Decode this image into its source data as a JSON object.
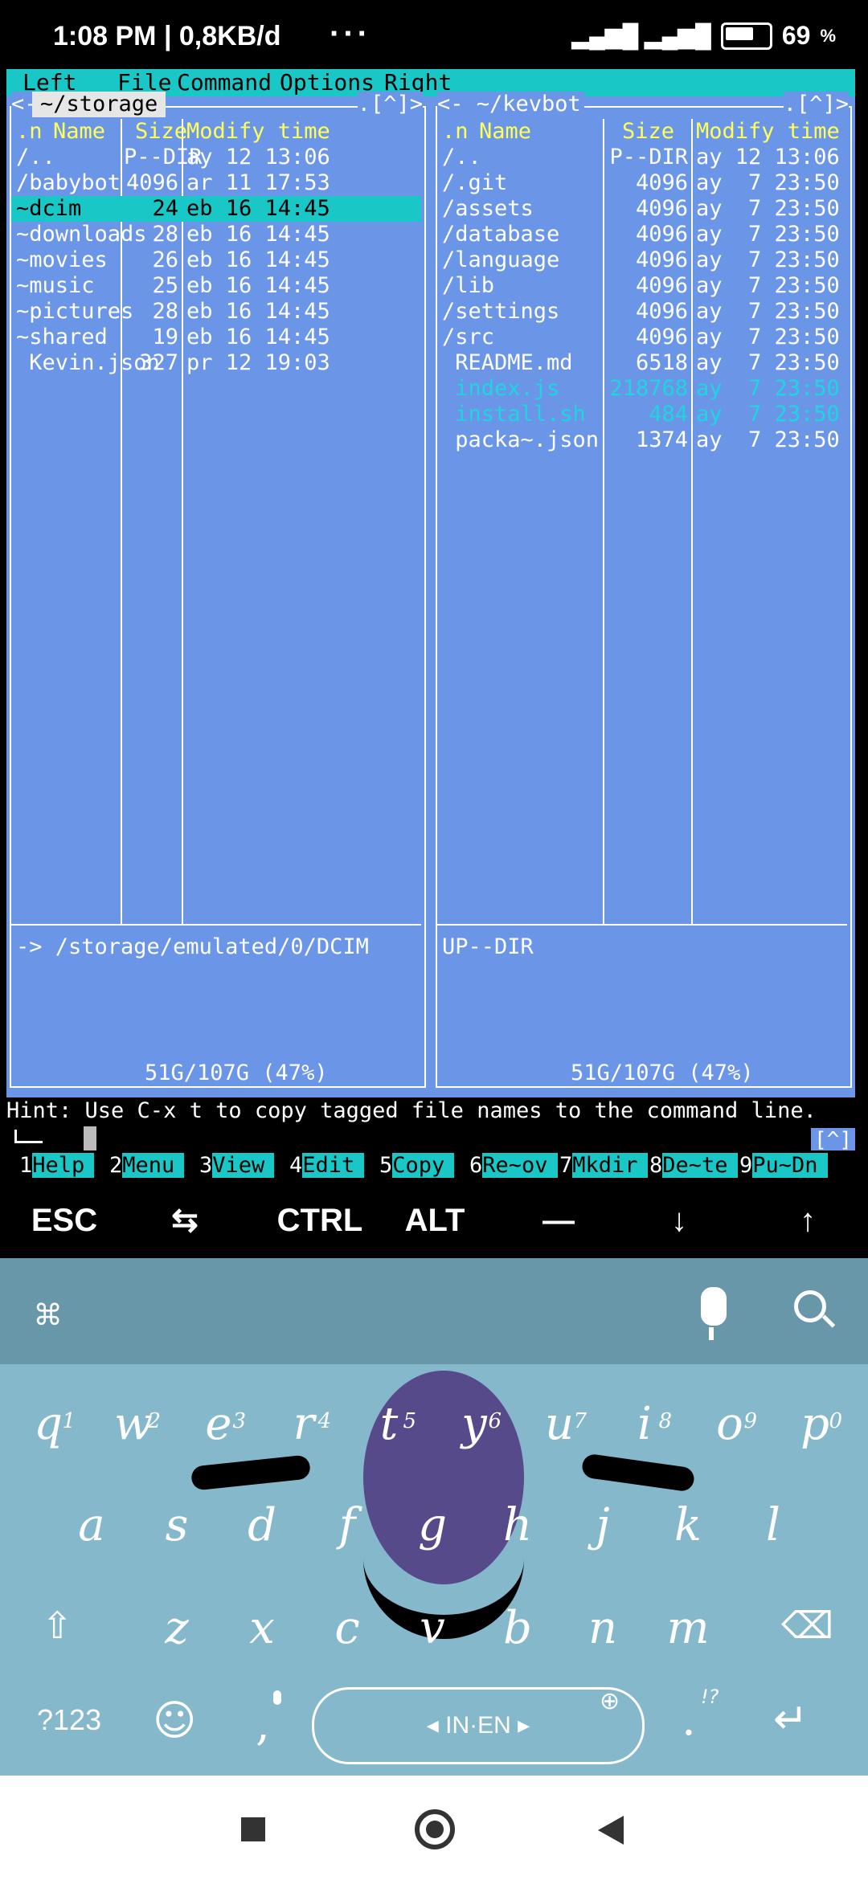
{
  "status": {
    "time": "1:08 PM | 0,8KB/d",
    "dots": "···",
    "battery": "69"
  },
  "menu": [
    "Left",
    "File",
    "Command",
    "Options",
    "Right"
  ],
  "left_panel": {
    "path": "~/storage",
    "corner": ".[^]>",
    "headers": {
      "n": ".n",
      "name": "Name",
      "size": "Size",
      "time": "Modify time"
    },
    "rows": [
      {
        "name": "/..",
        "size": "P--DIR",
        "time": "ay 12 13:06"
      },
      {
        "name": "/babybot",
        "size": "4096",
        "time": "ar 11 17:53"
      },
      {
        "name": "~dcim",
        "size": "24",
        "time": "eb 16 14:45"
      },
      {
        "name": "~downloads",
        "size": "28",
        "time": "eb 16 14:45"
      },
      {
        "name": "~movies",
        "size": "26",
        "time": "eb 16 14:45"
      },
      {
        "name": "~music",
        "size": "25",
        "time": "eb 16 14:45"
      },
      {
        "name": "~pictures",
        "size": "28",
        "time": "eb 16 14:45"
      },
      {
        "name": "~shared",
        "size": "19",
        "time": "eb 16 14:45"
      },
      {
        "name": " Kevin.json",
        "size": "327",
        "time": "pr 12 19:03"
      }
    ],
    "selected_row": "~dcim",
    "status_line": "-> /storage/emulated/0/DCIM",
    "disk": "51G/107G (47%)"
  },
  "right_panel": {
    "path": "<- ~/kevbot",
    "corner": ".[^]>",
    "headers": {
      "n": ".n",
      "name": "Name",
      "size": "Size",
      "time": "Modify time"
    },
    "rows": [
      {
        "name": "/..",
        "size": "P--DIR",
        "time": "ay 12 13:06"
      },
      {
        "name": "/.git",
        "size": "4096",
        "time": "ay  7 23:50"
      },
      {
        "name": "/assets",
        "size": "4096",
        "time": "ay  7 23:50"
      },
      {
        "name": "/database",
        "size": "4096",
        "time": "ay  7 23:50"
      },
      {
        "name": "/language",
        "size": "4096",
        "time": "ay  7 23:50"
      },
      {
        "name": "/lib",
        "size": "4096",
        "time": "ay  7 23:50"
      },
      {
        "name": "/settings",
        "size": "4096",
        "time": "ay  7 23:50"
      },
      {
        "name": "/src",
        "size": "4096",
        "time": "ay  7 23:50"
      },
      {
        "name": " README.md",
        "size": "6518",
        "time": "ay  7 23:50"
      },
      {
        "name": " index.js",
        "size": "218768",
        "time": "ay  7 23:50"
      },
      {
        "name": " install.sh",
        "size": "484",
        "time": "ay  7 23:50"
      },
      {
        "name": " packa~.json",
        "size": "1374",
        "time": "ay  7 23:50"
      }
    ],
    "status_line": "UP--DIR",
    "disk": "51G/107G (47%)"
  },
  "hint": "Hint: Use C-x t to copy tagged file names to the command line.",
  "hint_corner": "[^]",
  "fkeys": [
    {
      "n": "1",
      "label": "Help"
    },
    {
      "n": "2",
      "label": "Menu"
    },
    {
      "n": "3",
      "label": "View"
    },
    {
      "n": "4",
      "label": "Edit"
    },
    {
      "n": "5",
      "label": "Copy"
    },
    {
      "n": "6",
      "label": "Re~ov"
    },
    {
      "n": "7",
      "label": "Mkdir"
    },
    {
      "n": "8",
      "label": "De~te"
    },
    {
      "n": "9",
      "label": "Pu~Dn"
    }
  ],
  "extra_keys": [
    "ESC",
    "⇆",
    "CTRL",
    "ALT",
    "—",
    "↓",
    "↑"
  ],
  "keyboard": {
    "row1": [
      {
        "k": "q",
        "s": "1"
      },
      {
        "k": "w",
        "s": "2"
      },
      {
        "k": "e",
        "s": "3"
      },
      {
        "k": "r",
        "s": "4"
      },
      {
        "k": "t",
        "s": "5"
      },
      {
        "k": "y",
        "s": "6"
      },
      {
        "k": "u",
        "s": "7"
      },
      {
        "k": "i",
        "s": "8"
      },
      {
        "k": "o",
        "s": "9"
      },
      {
        "k": "p",
        "s": "0"
      }
    ],
    "row2": [
      "a",
      "s",
      "d",
      "f",
      "g",
      "h",
      "j",
      "k",
      "l"
    ],
    "row3": [
      "z",
      "x",
      "c",
      "v",
      "b",
      "n",
      "m"
    ],
    "sym_label": "?123",
    "comma": ",",
    "space_label": "IN·EN",
    "period": ".",
    "punct_hint": "!?"
  }
}
